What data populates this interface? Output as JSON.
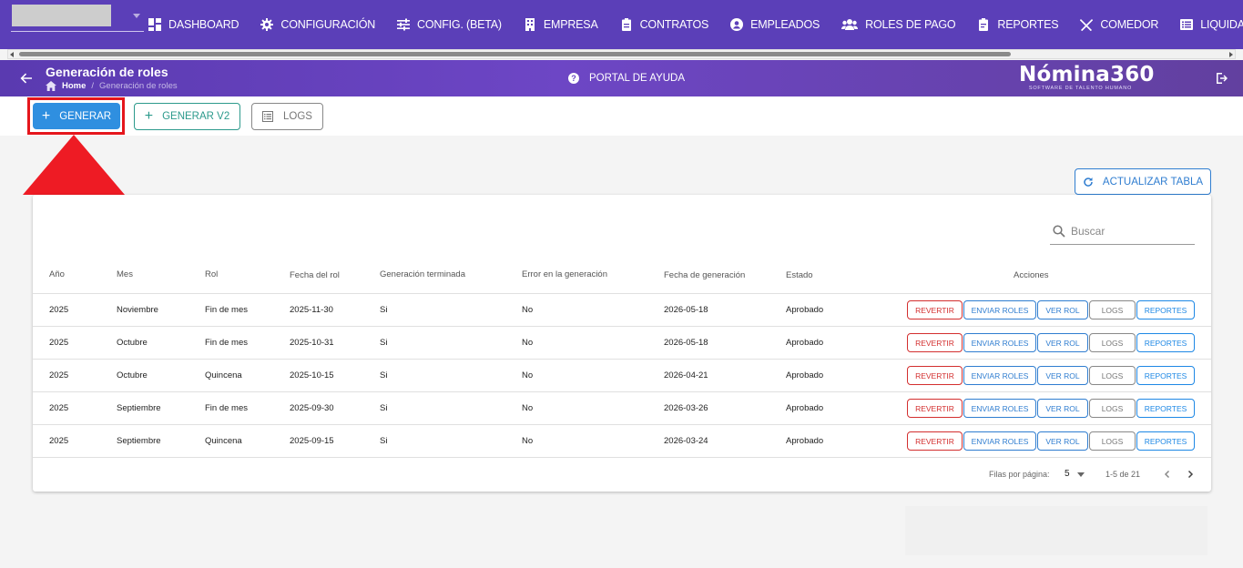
{
  "nav": {
    "items": [
      {
        "label": "DASHBOARD",
        "icon": "dashboard-icon"
      },
      {
        "label": "CONFIGURACIÓN",
        "icon": "gear-icon"
      },
      {
        "label": "CONFIG. (BETA)",
        "icon": "sliders-icon"
      },
      {
        "label": "EMPRESA",
        "icon": "building-icon"
      },
      {
        "label": "CONTRATOS",
        "icon": "clipboard-icon"
      },
      {
        "label": "EMPLEADOS",
        "icon": "user-circle-icon"
      },
      {
        "label": "ROLES DE PAGO",
        "icon": "users-icon"
      },
      {
        "label": "REPORTES",
        "icon": "report-icon"
      },
      {
        "label": "COMEDOR",
        "icon": "utensils-icon"
      },
      {
        "label": "LIQUIDACIONES",
        "icon": "list-icon"
      }
    ]
  },
  "header": {
    "title": "Generación de roles",
    "breadcrumb_home": "Home",
    "breadcrumb_current": "Generación de roles",
    "help_label": "PORTAL DE AYUDA",
    "logo_main": "Nómina360",
    "logo_sub": "SOFTWARE DE TALENTO HUMANO"
  },
  "actions": {
    "generar": "GENERAR",
    "generar_v2": "GENERAR V2",
    "logs": "LOGS",
    "refresh": "ACTUALIZAR TABLA"
  },
  "search": {
    "placeholder": "Buscar"
  },
  "table": {
    "headers": {
      "anio": "Año",
      "mes": "Mes",
      "rol": "Rol",
      "fecha_rol": "Fecha del rol",
      "gen_terminada": "Generación terminada",
      "error_gen": "Error en la generación",
      "fecha_gen": "Fecha de generación",
      "estado": "Estado",
      "acciones": "Acciones"
    },
    "action_labels": {
      "revertir": "REVERTIR",
      "enviar": "ENVIAR ROLES",
      "ver_rol": "VER ROL",
      "logs": "LOGS",
      "reportes": "REPORTES"
    },
    "rows": [
      {
        "anio": "2025",
        "mes": "Noviembre",
        "rol": "Fin de mes",
        "fecha_rol": "2025-11-30",
        "gen_terminada": "Si",
        "error_gen": "No",
        "fecha_gen": "2026-05-18",
        "estado": "Aprobado"
      },
      {
        "anio": "2025",
        "mes": "Octubre",
        "rol": "Fin de mes",
        "fecha_rol": "2025-10-31",
        "gen_terminada": "Si",
        "error_gen": "No",
        "fecha_gen": "2026-05-18",
        "estado": "Aprobado"
      },
      {
        "anio": "2025",
        "mes": "Octubre",
        "rol": "Quincena",
        "fecha_rol": "2025-10-15",
        "gen_terminada": "Si",
        "error_gen": "No",
        "fecha_gen": "2026-04-21",
        "estado": "Aprobado"
      },
      {
        "anio": "2025",
        "mes": "Septiembre",
        "rol": "Fin de mes",
        "fecha_rol": "2025-09-30",
        "gen_terminada": "Si",
        "error_gen": "No",
        "fecha_gen": "2026-03-26",
        "estado": "Aprobado"
      },
      {
        "anio": "2025",
        "mes": "Septiembre",
        "rol": "Quincena",
        "fecha_rol": "2025-09-15",
        "gen_terminada": "Si",
        "error_gen": "No",
        "fecha_gen": "2026-03-24",
        "estado": "Aprobado"
      }
    ]
  },
  "pagination": {
    "rows_per_page_label": "Filas por página:",
    "rows_per_page": "5",
    "range": "1-5 de 21"
  },
  "colors": {
    "nav_bg": "#5b3fb8",
    "primary": "#2f8fe0",
    "teal": "#2c9a8c",
    "danger": "#d32f2f",
    "highlight": "#e5161c"
  }
}
